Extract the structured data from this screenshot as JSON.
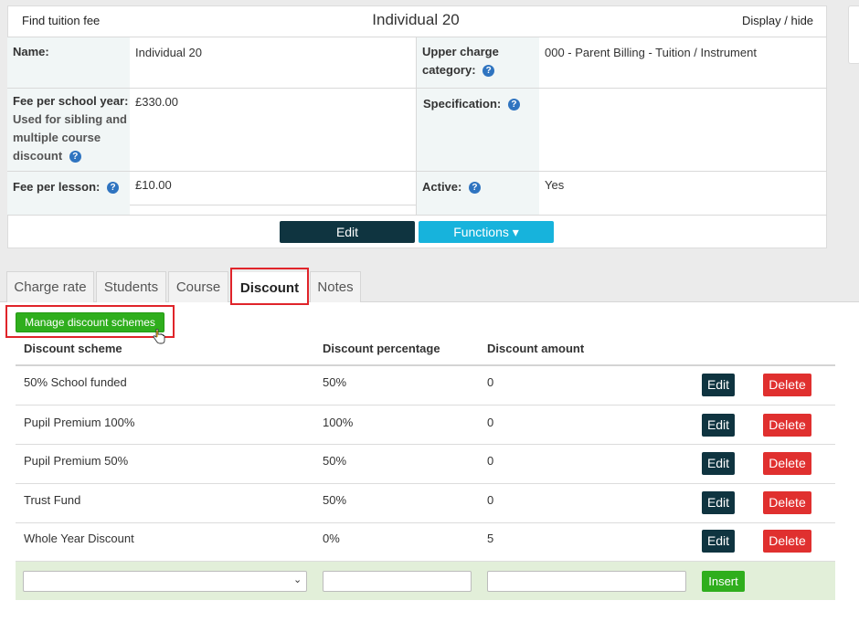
{
  "header": {
    "left_link": "Find tuition fee",
    "title": "Individual 20",
    "right_link": "Display / hide"
  },
  "details": {
    "name_label": "Name:",
    "name_value": "Individual 20",
    "upper_charge_label_1": "Upper charge",
    "upper_charge_label_2": "category:",
    "upper_charge_value": "000 - Parent Billing - Tuition / Instrument",
    "fee_year_label": "Fee per school year:",
    "fee_year_sub_1": "Used for sibling and",
    "fee_year_sub_2": "multiple course",
    "fee_year_sub_3": "discount",
    "fee_year_value": "£330.00",
    "specification_label": "Specification:",
    "specification_value": "",
    "fee_lesson_label": "Fee per lesson:",
    "fee_lesson_value": "£10.00",
    "active_label": "Active:",
    "active_value": "Yes",
    "help_glyph": "?"
  },
  "actions": {
    "edit_label": "Edit",
    "functions_label": "Functions ▾"
  },
  "tabs": [
    {
      "label": "Charge rate"
    },
    {
      "label": "Students"
    },
    {
      "label": "Course"
    },
    {
      "label": "Discount"
    },
    {
      "label": "Notes"
    }
  ],
  "discount": {
    "manage_label": "Manage discount schemes",
    "columns": [
      "Discount scheme",
      "Discount percentage",
      "Discount amount"
    ],
    "rows": [
      {
        "scheme": "50% School funded",
        "percentage": "50%",
        "amount": "0"
      },
      {
        "scheme": "Pupil Premium 100%",
        "percentage": "100%",
        "amount": "0"
      },
      {
        "scheme": "Pupil Premium 50%",
        "percentage": "50%",
        "amount": "0"
      },
      {
        "scheme": "Trust Fund",
        "percentage": "50%",
        "amount": "0"
      },
      {
        "scheme": "Whole Year Discount",
        "percentage": "0%",
        "amount": "5"
      }
    ],
    "edit_label": "Edit",
    "delete_label": "Delete",
    "insert_label": "Insert",
    "select_arrow": "⌄"
  },
  "colors": {
    "dark_button": "#0f3440",
    "functions_button": "#17b3dc",
    "delete_button": "#e0302f",
    "green_button": "#2fae1d",
    "highlight_border": "#e0242a",
    "insert_row": "#e2efd9"
  },
  "icons": {
    "cursor": "hand-pointer-icon"
  }
}
